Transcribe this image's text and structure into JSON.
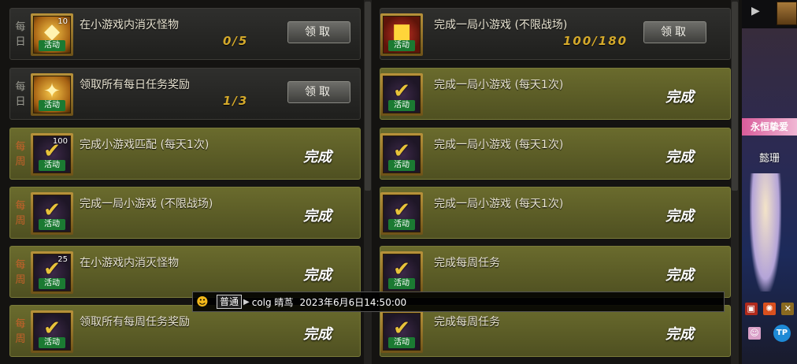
{
  "left_tasks": [
    {
      "freq": [
        "每",
        "日"
      ],
      "freq_type": "daily",
      "text": "在小游戏内消灭怪物",
      "icon": "gold-coin-icon",
      "icon_tag": "活动",
      "icon_count": "10",
      "progress": "0/5",
      "action": "领取",
      "state": "claim"
    },
    {
      "freq": [
        "每",
        "日"
      ],
      "freq_type": "daily",
      "text": "领取所有每日任务奖励",
      "icon": "gold-trophy-icon",
      "icon_tag": "活动",
      "icon_count": "",
      "progress": "1/3",
      "action": "领取",
      "state": "claim"
    },
    {
      "freq": [
        "每",
        "周"
      ],
      "freq_type": "weekly",
      "text": "完成小游戏匹配 (每天1次)",
      "icon": "check-shield-icon",
      "icon_tag": "活动",
      "icon_count": "100",
      "status": "完成",
      "state": "done"
    },
    {
      "freq": [
        "每",
        "周"
      ],
      "freq_type": "weekly",
      "text": "完成一局小游戏 (不限战场)",
      "icon": "check-shield-icon",
      "icon_tag": "活动",
      "icon_count": "",
      "status": "完成",
      "state": "done"
    },
    {
      "freq": [
        "每",
        "周"
      ],
      "freq_type": "weekly",
      "text": "在小游戏内消灭怪物",
      "icon": "check-shield-icon",
      "icon_tag": "活动",
      "icon_count": "25",
      "status": "完成",
      "state": "done"
    },
    {
      "freq": [
        "每",
        "周"
      ],
      "freq_type": "weekly",
      "text": "领取所有每周任务奖励",
      "icon": "check-shield-icon",
      "icon_tag": "活动",
      "icon_count": "",
      "status": "完成",
      "state": "done"
    }
  ],
  "right_tasks": [
    {
      "text": "完成一局小游戏 (不限战场)",
      "icon": "gift-box-icon",
      "icon_tag": "活动",
      "progress": "100/180",
      "action": "领取",
      "state": "claim"
    },
    {
      "text": "完成一局小游戏 (每天1次)",
      "icon": "check-shield-icon",
      "icon_tag": "活动",
      "status": "完成",
      "state": "done"
    },
    {
      "text": "完成一局小游戏 (每天1次)",
      "icon": "check-shield-icon",
      "icon_tag": "活动",
      "status": "完成",
      "state": "done"
    },
    {
      "text": "完成一局小游戏 (每天1次)",
      "icon": "check-shield-icon",
      "icon_tag": "活动",
      "status": "完成",
      "state": "done"
    },
    {
      "text": "完成每周任务",
      "icon": "check-shield-icon",
      "icon_tag": "活动",
      "status": "完成",
      "state": "done"
    },
    {
      "text": "完成每周任务",
      "icon": "check-shield-icon",
      "icon_tag": "活动",
      "status": "完成",
      "state": "done"
    }
  ],
  "chat": {
    "channel": "普通",
    "sender": "colg 晴茑",
    "time": "2023年6月6日14:50:00"
  },
  "side_panel": {
    "banner": "永恒挚爱",
    "name": "懿珊",
    "tp_label": "TP"
  },
  "colors": {
    "weekly_label": "#c6612a",
    "daily_label": "#9b9b92",
    "progress": "#d4a92b",
    "done_row": "#5e5f27",
    "pending_row": "#2a2a28"
  }
}
